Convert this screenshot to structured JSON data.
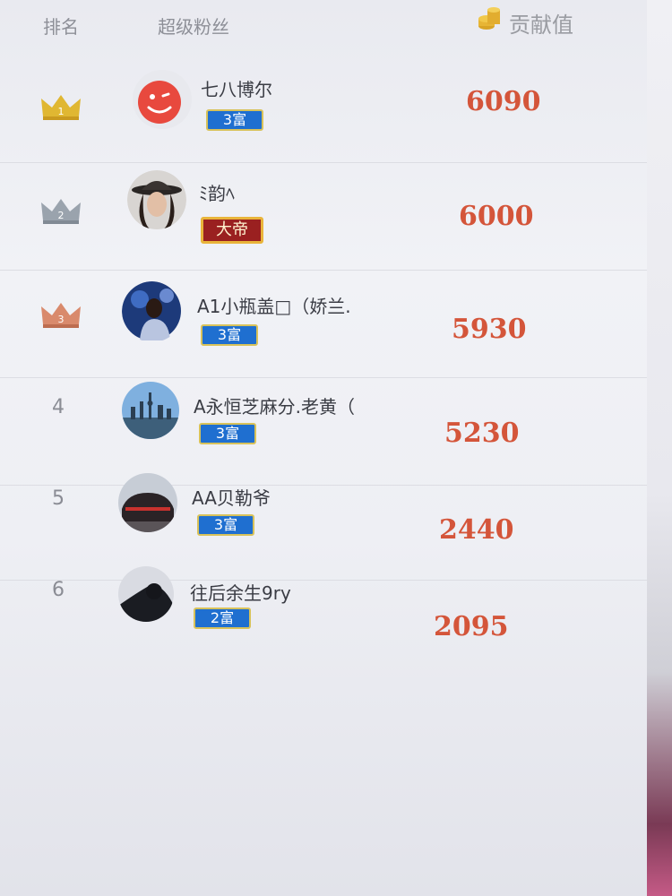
{
  "header": {
    "rank_label": "排名",
    "fan_label": "超级粉丝",
    "contribution_label": "贡献值"
  },
  "rows": [
    {
      "rank": "1",
      "name": "七八博尔",
      "badge": "3富",
      "score": "6090",
      "crown_color": "#e0b732"
    },
    {
      "rank": "2",
      "name": "ﾐ韵ﾍ",
      "badge": "大帝",
      "score": "6000",
      "crown_color": "#9aa3ad"
    },
    {
      "rank": "3",
      "name": "A1小瓶盖□（娇兰.",
      "badge": "3富",
      "score": "5930",
      "crown_color": "#d98a6c"
    },
    {
      "rank": "4",
      "name": "A永恒芝麻分.老黄（",
      "badge": "3富",
      "score": "5230"
    },
    {
      "rank": "5",
      "name": "AA贝勒爷",
      "badge": "3富",
      "score": "2440"
    },
    {
      "rank": "6",
      "name": "往后余生9ry",
      "badge": "2富",
      "score": "2095"
    }
  ]
}
